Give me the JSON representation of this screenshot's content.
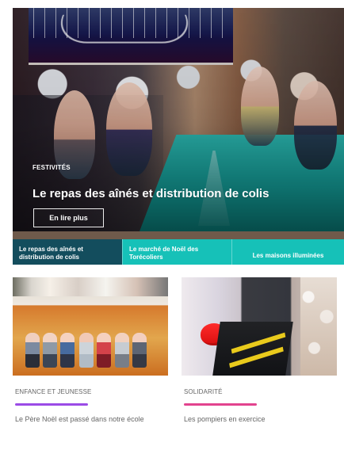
{
  "hero": {
    "category": "FESTIVITÉS",
    "title": "Le repas des aînés et distribution de colis",
    "button_label": "En lire plus",
    "tabs": [
      "Le repas des aînés et distribution de colis",
      "Le marché de Noël des Torécoliers",
      "Les maisons illuminées"
    ]
  },
  "cards": [
    {
      "category": "ENFANCE ET JEUNESSE",
      "title": "Le Père Noël est passé dans notre école",
      "accent": "#9b4be6"
    },
    {
      "category": "SOLIDARITÉ",
      "title": "Les pompiers en exercice",
      "accent": "#e2438e"
    }
  ]
}
